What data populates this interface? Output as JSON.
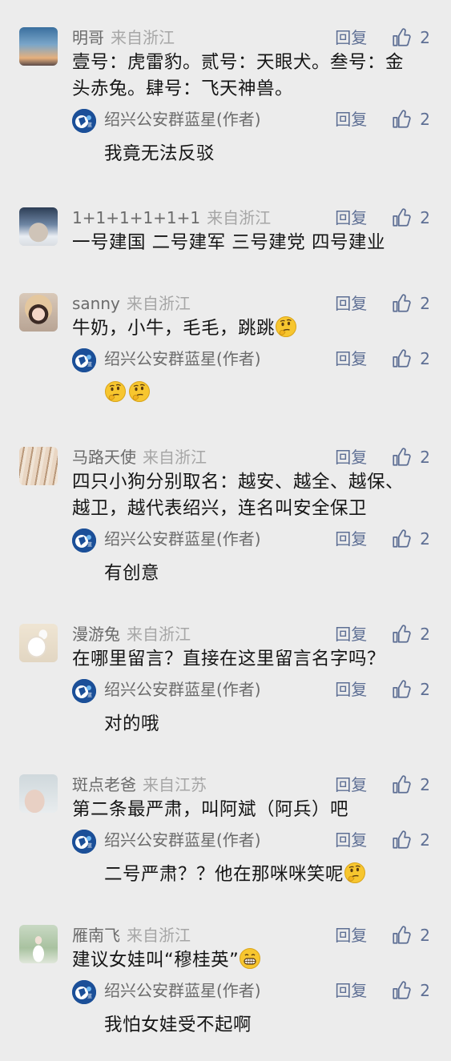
{
  "reply_label": "回复",
  "author_tag": "(作者)",
  "comments": [
    {
      "name": "明哥",
      "location": "来自浙江",
      "likes": "2",
      "text": "壹号：虎雷豹。贰号：天眼犬。叁号：金头赤兔。肆号：飞天神兽。",
      "reply": {
        "name": "绍兴公安群蓝星",
        "likes": "2",
        "text": "我竟无法反驳"
      }
    },
    {
      "name": "1+1+1+1+1+1",
      "location": "来自浙江",
      "likes": "2",
      "text": "一号建国 二号建军 三号建党 四号建业"
    },
    {
      "name": "sanny",
      "location": "来自浙江",
      "likes": "2",
      "text": "牛奶，小牛，毛毛，跳跳",
      "reply": {
        "name": "绍兴公安群蓝星",
        "likes": "2",
        "text": ""
      }
    },
    {
      "name": "马路天使",
      "location": "来自浙江",
      "likes": "2",
      "text": "四只小狗分别取名：越安、越全、越保、越卫，越代表绍兴，连名叫安全保卫",
      "reply": {
        "name": "绍兴公安群蓝星",
        "likes": "2",
        "text": "有创意"
      }
    },
    {
      "name": "漫游兔",
      "location": "来自浙江",
      "likes": "2",
      "text": "在哪里留言？直接在这里留言名字吗？",
      "reply": {
        "name": "绍兴公安群蓝星",
        "likes": "2",
        "text": "对的哦"
      }
    },
    {
      "name": "斑点老爸",
      "location": "来自江苏",
      "likes": "2",
      "text": "第二条最严肃，叫阿斌（阿兵）吧",
      "reply": {
        "name": "绍兴公安群蓝星",
        "likes": "2",
        "text": "二号严肃？？他在那咪咪笑呢"
      }
    },
    {
      "name": "雁南飞",
      "location": "来自浙江",
      "likes": "2",
      "text": "建议女娃叫“穆桂英”",
      "reply": {
        "name": "绍兴公安群蓝星",
        "likes": "2",
        "text": "我怕女娃受不起啊"
      }
    }
  ],
  "colors": {
    "background": "#ececec",
    "link": "#5e6f94",
    "muted": "#a6a6a6"
  },
  "icons": [
    "thumbs-up-icon",
    "thinking-emoji",
    "grinning-emoji"
  ]
}
